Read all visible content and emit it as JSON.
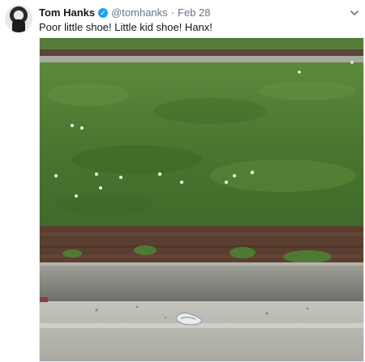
{
  "tweet": {
    "author_name": "Tom Hanks",
    "handle": "@tomhanks",
    "separator": "·",
    "date": "Feb 28",
    "text": "Poor little shoe!  Little kid shoe!  Hanx!",
    "verified_icon": "verified-badge-icon",
    "menu_icon": "chevron-down-icon"
  },
  "colors": {
    "name": "#14171a",
    "meta": "#657786",
    "verified": "#1da1f2",
    "grass": "#4e7a34",
    "mulch": "#5a3e2e",
    "curb": "#8f8f88",
    "road": "#b9b8b1"
  }
}
